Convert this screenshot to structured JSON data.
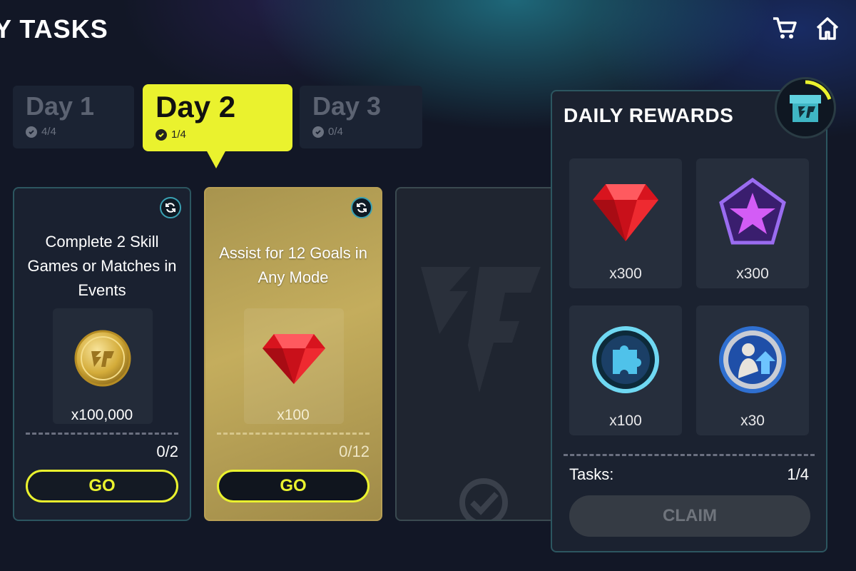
{
  "header": {
    "title": "Y TASKS",
    "cart_icon": "cart-icon",
    "home_icon": "home-icon"
  },
  "days": [
    {
      "label": "Day 1",
      "progress": "4/4"
    },
    {
      "label": "Day 2",
      "progress": "1/4"
    },
    {
      "label": "Day 3",
      "progress": "0/4"
    }
  ],
  "tasks": [
    {
      "text": "Complete 2 Skill Games or Matches in Events",
      "reward_amount": "x100,000",
      "reward_icon": "coin-icon",
      "progress": "0/2",
      "button": "GO"
    },
    {
      "text": "Assist for 12 Goals in Any Mode",
      "reward_amount": "x100",
      "reward_icon": "gem-icon",
      "progress": "0/12",
      "button": "GO"
    }
  ],
  "daily_rewards": {
    "title": "DAILY REWARDS",
    "items": [
      {
        "amount": "x300",
        "icon": "red-gem-icon"
      },
      {
        "amount": "x300",
        "icon": "purple-star-icon"
      },
      {
        "amount": "x100",
        "icon": "puzzle-icon"
      },
      {
        "amount": "x30",
        "icon": "player-upgrade-icon"
      }
    ],
    "tasks_label": "Tasks:",
    "tasks_value": "1/4",
    "claim_label": "CLAIM"
  },
  "colors": {
    "accent": "#eaf22e",
    "panel": "#1b2230",
    "card_gold": "#c4ad5d",
    "border_teal": "#2c5660"
  }
}
